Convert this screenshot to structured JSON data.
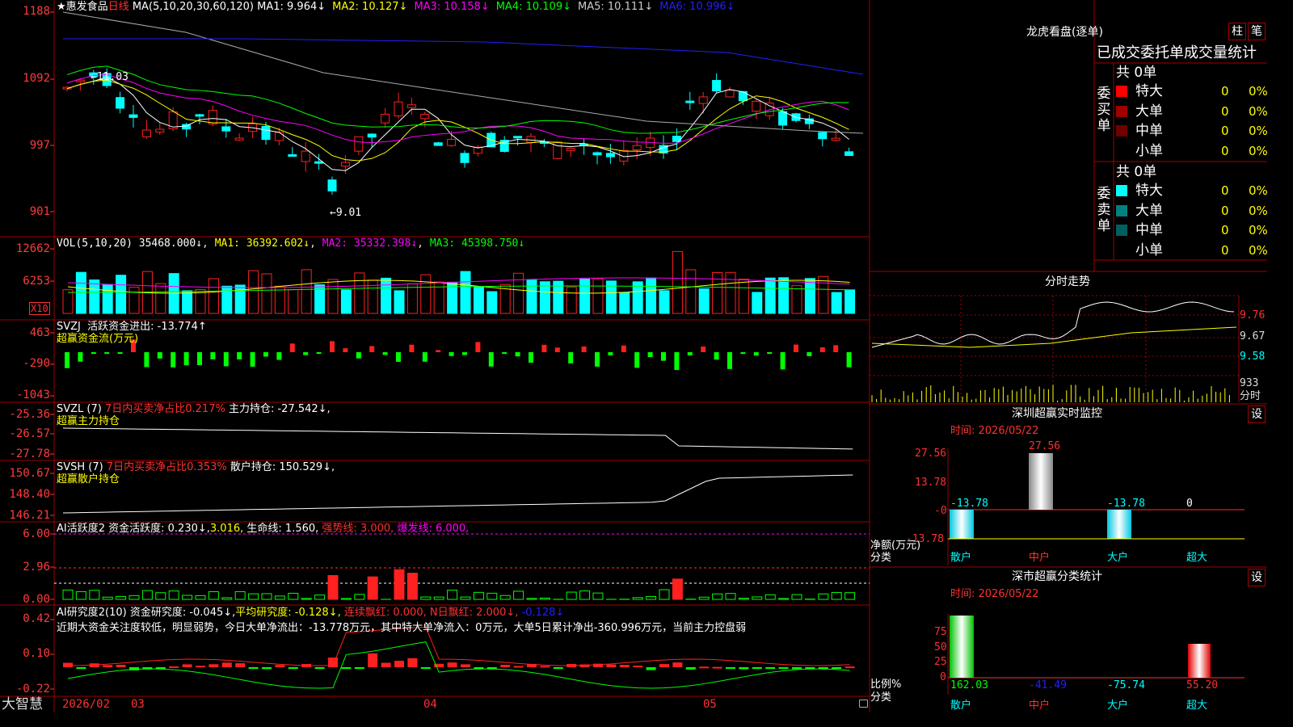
{
  "colors": {
    "up": "#ff2020",
    "down": "#00ffff",
    "ma5": "#ffffff",
    "ma10": "#ffff00",
    "ma20": "#ff00ff",
    "ma30": "#00ff00",
    "ma60": "#999999",
    "ma120": "#2020ff",
    "grid": "#a00000"
  },
  "main": {
    "stock_name": "惠发食品",
    "period": "日线",
    "ma_spec": "MA(5,10,20,30,60,120)",
    "ma_items": [
      {
        "label": "MA1: 9.964↓",
        "color": "#ffffff"
      },
      {
        "label": "MA2: 10.127↓",
        "color": "#ffff00"
      },
      {
        "label": "MA3: 10.158↓",
        "color": "#ff00ff"
      },
      {
        "label": "MA4: 10.109↓",
        "color": "#00ff00"
      },
      {
        "label": "MA5: 10.111↓",
        "color": "#cccccc"
      },
      {
        "label": "MA6: 10.996↓",
        "color": "#2020ff"
      }
    ],
    "y_ticks": [
      "1188",
      "1092",
      "997",
      "901"
    ],
    "hi_label": "←11.03",
    "lo_label": "←9.01",
    "x_labels": [
      "2026/02",
      "03",
      "04",
      "05"
    ],
    "bottom_brand": "大智慧"
  },
  "vol": {
    "title": "VOL(5,10,20)",
    "value": "35468.000↓",
    "ma1": "MA1: 36392.602↓",
    "ma2": "MA2: 35332.398↓",
    "ma3": "MA3: 45398.750↓",
    "y_ticks": [
      "12662",
      "6253"
    ],
    "unit": "X10"
  },
  "svzj": {
    "title": "SVZJ",
    "desc": "活跃资金进出: -13.774↑",
    "sub": "超赢资金流(万元)",
    "y_ticks": [
      "463",
      "-290",
      "-1043"
    ]
  },
  "svzl": {
    "title": "SVZL (7)",
    "desc1": "7日内买卖净占比0.217%",
    "desc2": "主力持仓: -27.542↓,",
    "sub": "超赢主力持仓",
    "y_ticks": [
      "-25.36",
      "-26.57",
      "-27.78"
    ]
  },
  "svsh": {
    "title": "SVSH (7)",
    "desc1": "7日内买卖净占比0.353%",
    "desc2": "散户持仓: 150.529↓,",
    "sub": "超赢散户持仓",
    "y_ticks": [
      "150.67",
      "148.40",
      "146.21"
    ]
  },
  "ai1": {
    "title": "AI活跃度2",
    "a": "资金活跃度: 0.230↓,",
    "b": "3.016,",
    "c": "生命线: 1.560,",
    "d": "强势线: 3.000,",
    "e": "爆发线: 6.000,",
    "y_ticks": [
      "6.00",
      "2.96",
      "0.00"
    ]
  },
  "ai2": {
    "title": "AI研究度2(10)",
    "a": "资金研究度: -0.045↓,",
    "b": "平均研究度: -0.128↓,",
    "c": "连续飘红: 0.000,",
    "d": "N日飘红: 2.000↓,",
    "e": "-0.128↓",
    "comment": "近期大资金关注度较低，明显弱势，今日大单净流出：-13.778万元，其中特大单净流入：0万元，大单5日累计净出-360.996万元，当前主力控盘弱",
    "y_ticks": [
      "0.42",
      "0.10",
      "-0.22"
    ]
  },
  "right": {
    "lhb_title": "龙虎看盘(逐单)",
    "btn_zhu": "柱",
    "btn_bi": "笔",
    "tabs": [
      "已成交",
      "委托单",
      "成交量统计"
    ],
    "buy_label": "委买单",
    "sell_label": "委卖单",
    "buy_total": "共 0单",
    "sell_total": "共 0单",
    "buy_rows": [
      {
        "name": "特大",
        "qty": "0",
        "pct": "0%",
        "color": "#ff0000"
      },
      {
        "name": "大单",
        "qty": "0",
        "pct": "0%",
        "color": "#a00000"
      },
      {
        "name": "中单",
        "qty": "0",
        "pct": "0%",
        "color": "#700000"
      },
      {
        "name": "小单",
        "qty": "0",
        "pct": "0%",
        "color": ""
      }
    ],
    "sell_rows": [
      {
        "name": "特大",
        "qty": "0",
        "pct": "0%",
        "color": "#00ffff"
      },
      {
        "name": "大单",
        "qty": "0",
        "pct": "0%",
        "color": "#008080"
      },
      {
        "name": "中单",
        "qty": "0",
        "pct": "0%",
        "color": "#006060"
      },
      {
        "name": "小单",
        "qty": "0",
        "pct": "0%",
        "color": ""
      }
    ],
    "intraday_title": "分时走势",
    "intraday_ticks": [
      "9.76",
      "9.67",
      "9.58",
      "933",
      "分时"
    ],
    "sz_monitor_title": "深圳超赢实时监控",
    "set_label": "设",
    "time_label": "时间: 2026/05/22",
    "mon_ticks": [
      "27.56",
      "13.78",
      "-0",
      "-13.78"
    ],
    "mon_values": [
      {
        "cat": "散户",
        "val": "-13.78"
      },
      {
        "cat": "中户",
        "val": "27.56"
      },
      {
        "cat": "大户",
        "val": "-13.78"
      },
      {
        "cat": "超大",
        "val": "0"
      }
    ],
    "net_label": "净额(万元)",
    "cls_label": "分类",
    "stat_title": "深市超赢分类统计",
    "stat_ticks": [
      "75",
      "50",
      "25",
      "0"
    ],
    "stat_values": [
      {
        "cat": "散户",
        "val": "162.03"
      },
      {
        "cat": "中户",
        "val": "-41.49"
      },
      {
        "cat": "大户",
        "val": "-75.74"
      },
      {
        "cat": "超大",
        "val": "55.20"
      }
    ],
    "ratio_label": "比例%"
  }
}
